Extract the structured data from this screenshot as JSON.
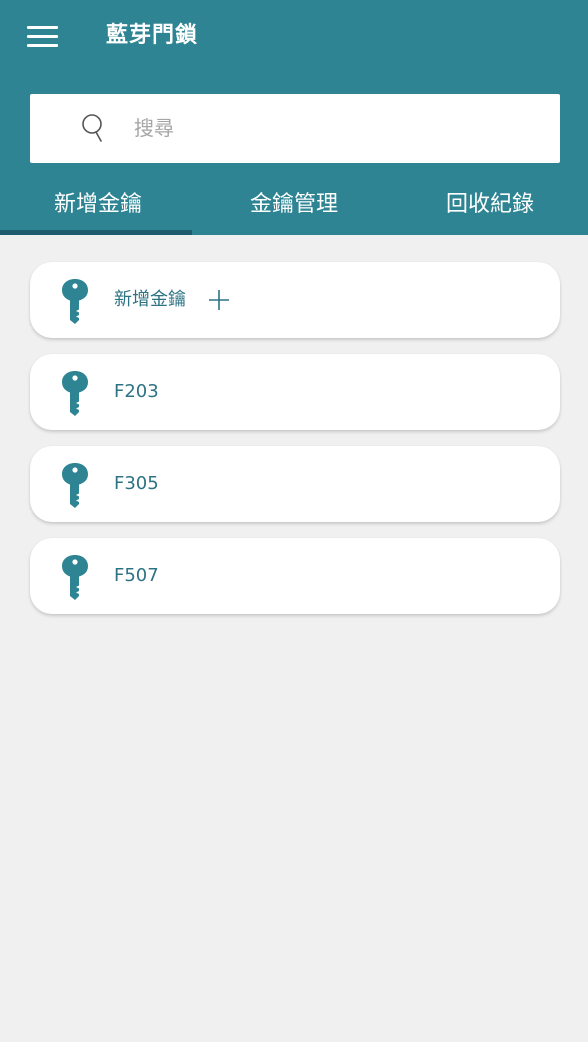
{
  "header": {
    "title": "藍芽門鎖",
    "menu_icon": "menu-icon"
  },
  "search": {
    "placeholder": "搜尋",
    "value": "",
    "icon": "search-icon"
  },
  "tabs": [
    {
      "label": "新增金鑰",
      "active": true
    },
    {
      "label": "金鑰管理",
      "active": false
    },
    {
      "label": "回收紀錄",
      "active": false
    }
  ],
  "keys": [
    {
      "label": "新增金鑰",
      "icon": "key-icon",
      "trailing_icon": "plus-icon"
    },
    {
      "label": "F203",
      "icon": "key-icon"
    },
    {
      "label": "F305",
      "icon": "key-icon"
    },
    {
      "label": "F507",
      "icon": "key-icon"
    }
  ],
  "colors": {
    "primary": "#2e8493",
    "tab_indicator": "#1d5c6c",
    "accent_text": "#2e7384",
    "background": "#f0f0f0"
  }
}
